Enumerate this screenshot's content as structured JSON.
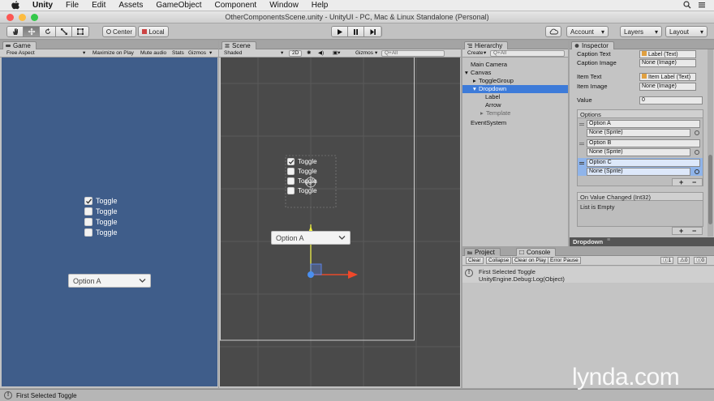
{
  "menubar": {
    "app_name": "Unity",
    "items": [
      "File",
      "Edit",
      "Assets",
      "GameObject",
      "Component",
      "Window",
      "Help"
    ]
  },
  "window": {
    "title": "OtherComponentsScene.unity - UnityUI - PC, Mac & Linux Standalone (Personal)"
  },
  "toolbar": {
    "center_label": "Center",
    "local_label": "Local",
    "account_label": "Account",
    "layers_label": "Layers",
    "layout_label": "Layout"
  },
  "game": {
    "tab_label": "Game",
    "aspect": "Free Aspect",
    "maximize": "Maximize on Play",
    "mute": "Mute audio",
    "stats": "Stats",
    "gizmos": "Gizmos",
    "toggles": [
      "Toggle",
      "Toggle",
      "Toggle",
      "Toggle"
    ],
    "dropdown_value": "Option A"
  },
  "scene": {
    "tab_label": "Scene",
    "shading": "Shaded",
    "mode_2d": "2D",
    "gizmos": "Gizmos",
    "search_placeholder": "Q+All",
    "toggles": [
      "Toggle",
      "Toggle",
      "Toggle",
      "Toggle"
    ],
    "dropdown_value": "Option A"
  },
  "hierarchy": {
    "tab_label": "Hierarchy",
    "create_label": "Create",
    "search_placeholder": "Q+All",
    "items": [
      {
        "label": "Main Camera"
      },
      {
        "label": "Canvas"
      },
      {
        "label": "ToggleGroup"
      },
      {
        "label": "Dropdown"
      },
      {
        "label": "Label"
      },
      {
        "label": "Arrow"
      },
      {
        "label": "Template"
      },
      {
        "label": "EventSystem"
      }
    ]
  },
  "inspector": {
    "tab_label": "Inspector",
    "fields": [
      {
        "label": "Caption Text",
        "value": "Label (Text)"
      },
      {
        "label": "Caption Image",
        "value": "None (Image)"
      },
      {
        "label": "Item Text",
        "value": "Item Label (Text)"
      },
      {
        "label": "Item Image",
        "value": "None (Image)"
      },
      {
        "label": "Value",
        "value": "0"
      }
    ],
    "options_header": "Options",
    "options": [
      {
        "text": "Option A",
        "sprite": "None (Sprite)"
      },
      {
        "text": "Option B",
        "sprite": "None (Sprite)"
      },
      {
        "text": "Option C",
        "sprite": "None (Sprite)"
      }
    ],
    "plus": "+",
    "minus": "−",
    "event_header": "On Value Changed (Int32)",
    "event_empty": "List is Empty",
    "footer_label": "Dropdown"
  },
  "project": {
    "tab_label": "Project"
  },
  "console": {
    "tab_label": "Console",
    "clear": "Clear",
    "collapse": "Collapse",
    "clear_on_play": "Clear on Play",
    "error_pause": "Error Pause",
    "count_log": "1",
    "count_warn": "0",
    "count_err": "0",
    "entry_line1": "First Selected Toggle",
    "entry_line2": "UnityEngine.Debug:Log(Object)"
  },
  "status": {
    "text": "First Selected Toggle"
  },
  "watermark": "lynda.com",
  "colors": {
    "game_bg": "#3f5d8a",
    "scene_bg": "#4a4a4a",
    "selection": "#3d7bd9",
    "option_selected": "#8fb4ea"
  }
}
